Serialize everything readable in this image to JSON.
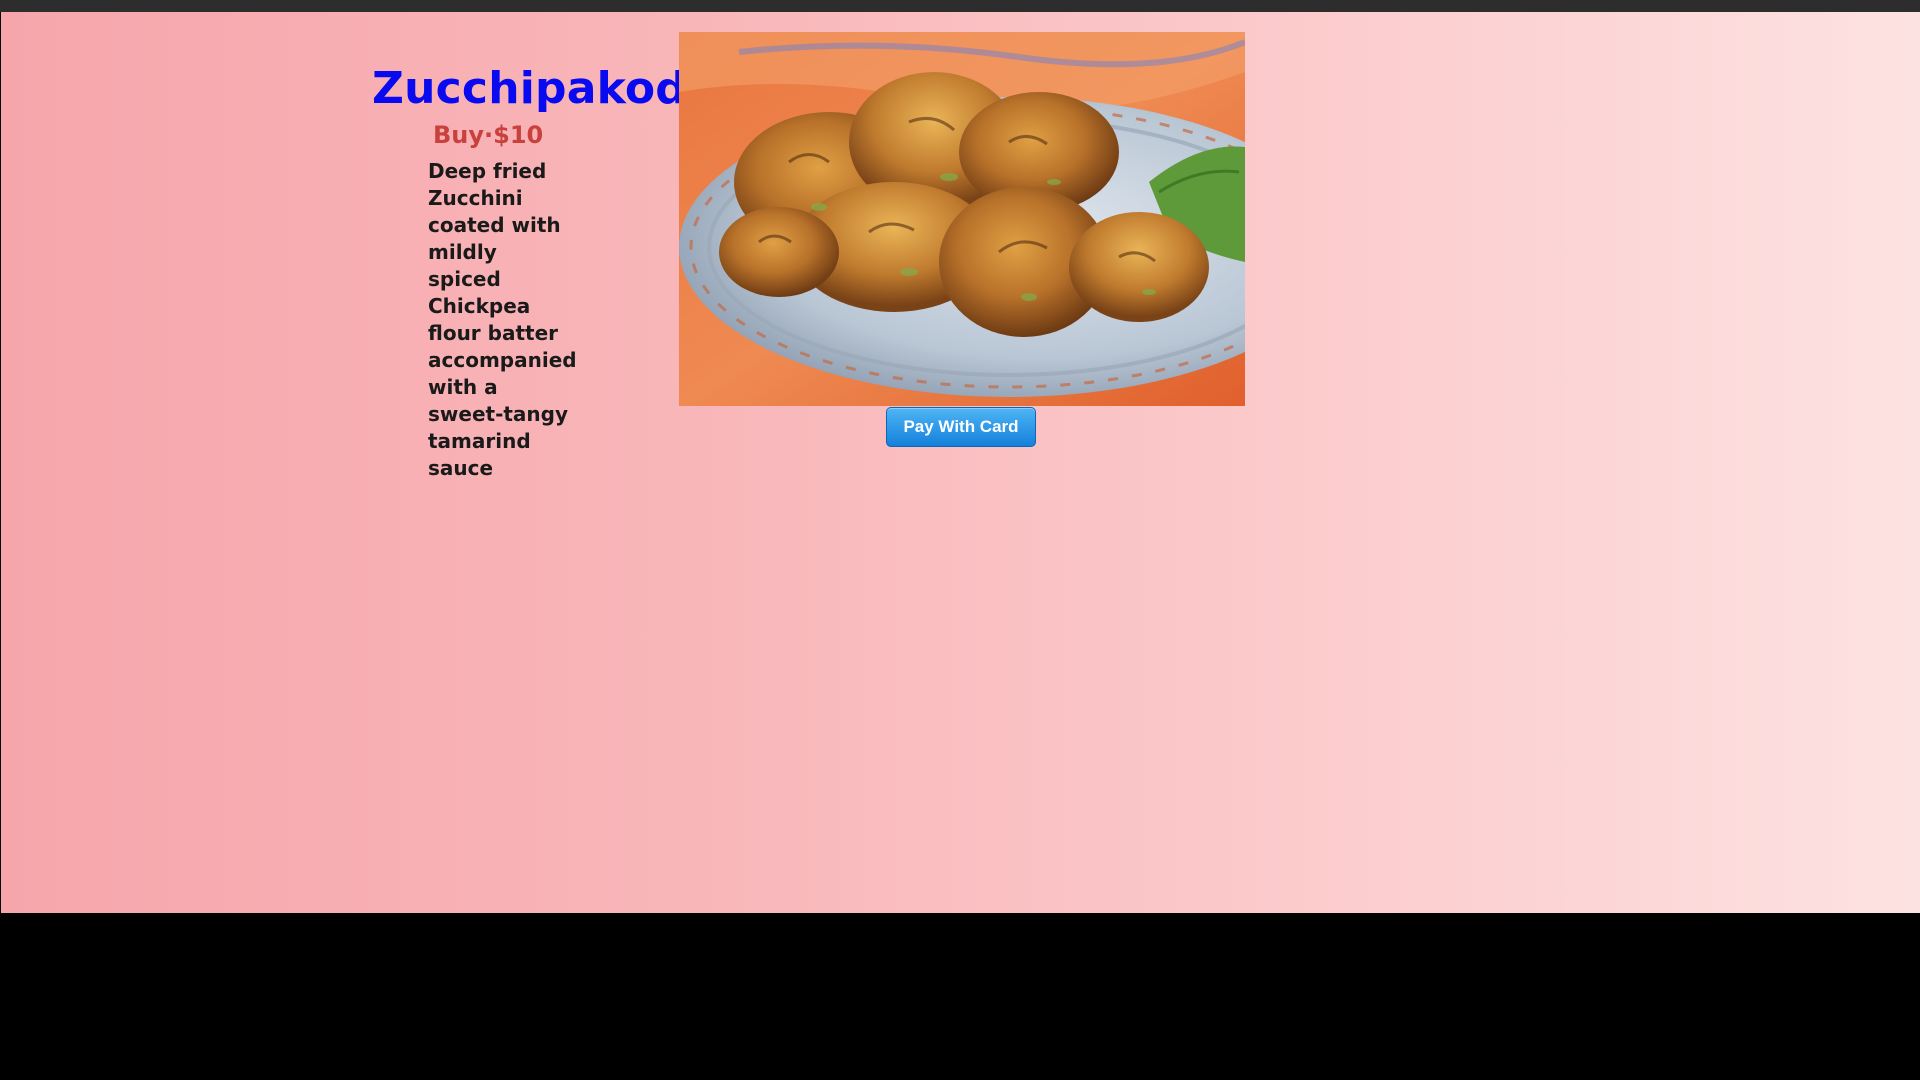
{
  "product": {
    "title": "Zucchipakoda",
    "buy_label": "Buy·$10",
    "description": "Deep fried Zucchini coated with mildly spiced Chickpea flour batter accompanied with a sweet-tangy tamarind sauce",
    "image_alt": "Zucchipakoda"
  },
  "checkout": {
    "pay_button_label": "Pay With Card"
  },
  "colors": {
    "title": "#0a0af0",
    "price": "#c8413c",
    "button": "#1480db",
    "background_start": "#f6a6ab",
    "background_end": "#fde2e2"
  },
  "icons": {
    "photo": "food-photo"
  }
}
